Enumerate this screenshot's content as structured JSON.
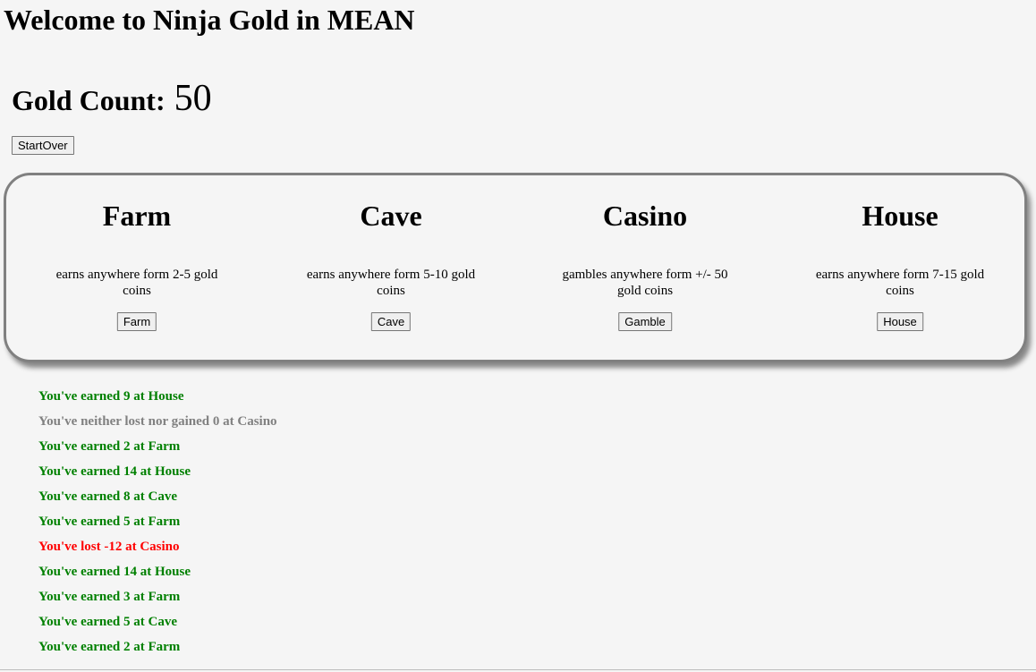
{
  "header": {
    "title": "Welcome to Ninja Gold in MEAN"
  },
  "gold": {
    "label": "Gold Count:",
    "value": "50"
  },
  "controls": {
    "start_over_label": "StartOver"
  },
  "locations": [
    {
      "name": "Farm",
      "description": "earns anywhere form 2-5 gold coins",
      "button_label": "Farm"
    },
    {
      "name": "Cave",
      "description": "earns anywhere form 5-10 gold coins",
      "button_label": "Cave"
    },
    {
      "name": "Casino",
      "description": "gambles anywhere form +/- 50 gold coins",
      "button_label": "Gamble"
    },
    {
      "name": "House",
      "description": "earns anywhere form 7-15 gold coins",
      "button_label": "House"
    }
  ],
  "colors": {
    "earned": "#008000",
    "neutral": "#808080",
    "lost": "#ff0000"
  },
  "activity_log": [
    {
      "text": "You've earned 9 at House",
      "status": "earned"
    },
    {
      "text": "You've neither lost nor gained 0 at Casino",
      "status": "neutral"
    },
    {
      "text": "You've earned 2 at Farm",
      "status": "earned"
    },
    {
      "text": "You've earned 14 at House",
      "status": "earned"
    },
    {
      "text": "You've earned 8 at Cave",
      "status": "earned"
    },
    {
      "text": "You've earned 5 at Farm",
      "status": "earned"
    },
    {
      "text": "You've lost -12 at Casino",
      "status": "lost"
    },
    {
      "text": "You've earned 14 at House",
      "status": "earned"
    },
    {
      "text": "You've earned 3 at Farm",
      "status": "earned"
    },
    {
      "text": "You've earned 5 at Cave",
      "status": "earned"
    },
    {
      "text": "You've earned 2 at Farm",
      "status": "earned"
    }
  ]
}
